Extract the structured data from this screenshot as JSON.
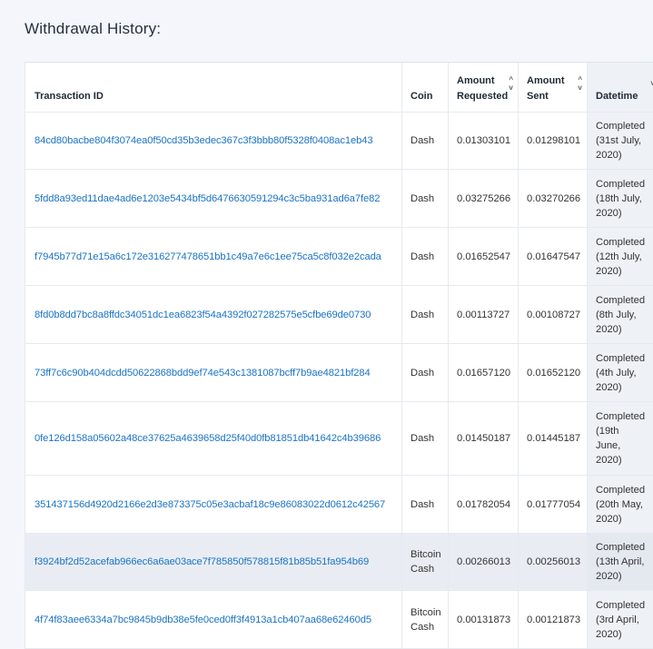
{
  "page": {
    "title": "Withdrawal History:"
  },
  "table": {
    "headers": {
      "txid": "Transaction ID",
      "coin": "Coin",
      "requested_1": "Amount",
      "requested_2": "Requested",
      "sent_1": "Amount",
      "sent_2": "Sent",
      "datetime": "Datetime"
    },
    "sort_icons": {
      "up": "^",
      "down": "v"
    },
    "rows": [
      {
        "txid": "84cd80bacbe804f3074ea0f50cd35b3edec367c3f3bbb80f5328f0408ac1eb43",
        "coin": [
          "Dash"
        ],
        "requested": "0.01303101",
        "sent": "0.01298101",
        "status": [
          "Completed",
          "(31st July,",
          "2020)"
        ]
      },
      {
        "txid": "5fdd8a93ed11dae4ad6e1203e5434bf5d6476630591294c3c5ba931ad6a7fe82",
        "coin": [
          "Dash"
        ],
        "requested": "0.03275266",
        "sent": "0.03270266",
        "status": [
          "Completed",
          "(18th July,",
          "2020)"
        ]
      },
      {
        "txid": "f7945b77d71e15a6c172e316277478651bb1c49a7e6c1ee75ca5c8f032e2cada",
        "coin": [
          "Dash"
        ],
        "requested": "0.01652547",
        "sent": "0.01647547",
        "status": [
          "Completed",
          "(12th July,",
          "2020)"
        ]
      },
      {
        "txid": "8fd0b8dd7bc8a8ffdc34051dc1ea6823f54a4392f027282575e5cfbe69de0730",
        "coin": [
          "Dash"
        ],
        "requested": "0.00113727",
        "sent": "0.00108727",
        "status": [
          "Completed",
          "(8th July,",
          "2020)"
        ]
      },
      {
        "txid": "73ff7c6c90b404dcdd50622868bdd9ef74e543c1381087bcff7b9ae4821bf284",
        "coin": [
          "Dash"
        ],
        "requested": "0.01657120",
        "sent": "0.01652120",
        "status": [
          "Completed",
          "(4th July,",
          "2020)"
        ]
      },
      {
        "txid": "0fe126d158a05602a48ce37625a4639658d25f40d0fb81851db41642c4b39686",
        "coin": [
          "Dash"
        ],
        "requested": "0.01450187",
        "sent": "0.01445187",
        "status": [
          "Completed",
          "(19th",
          "June,",
          "2020)"
        ]
      },
      {
        "txid": "351437156d4920d2166e2d3e873375c05e3acbaf18c9e86083022d0612c42567",
        "coin": [
          "Dash"
        ],
        "requested": "0.01782054",
        "sent": "0.01777054",
        "status": [
          "Completed",
          "(20th May,",
          "2020)"
        ]
      },
      {
        "txid": "f3924bf2d52acefab966ec6a6ae03ace7f785850f578815f81b85b51fa954b69",
        "coin": [
          "Bitcoin",
          "Cash"
        ],
        "requested": "0.00266013",
        "sent": "0.00256013",
        "status": [
          "Completed",
          "(13th April,",
          "2020)"
        ],
        "highlighted": true
      },
      {
        "txid": "4f74f83aee6334a7bc9845b9db38e5fe0ced0ff3f4913a1cb407aa68e62460d5",
        "coin": [
          "Bitcoin",
          "Cash"
        ],
        "requested": "0.00131873",
        "sent": "0.00121873",
        "status": [
          "Completed",
          "(3rd April,",
          "2020)"
        ]
      }
    ]
  }
}
